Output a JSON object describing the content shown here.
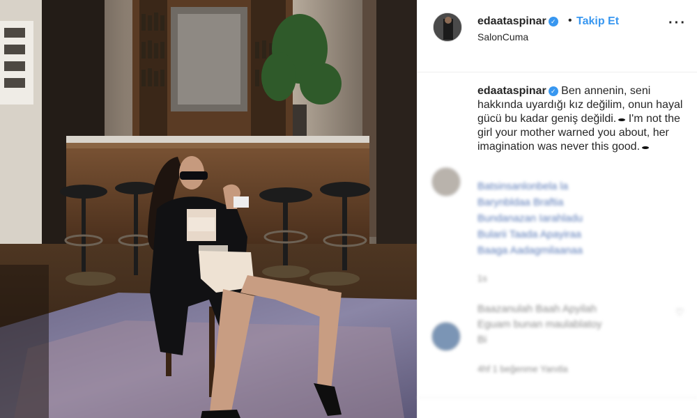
{
  "post": {
    "username": "edaataspinar",
    "follow_separator": "•",
    "follow_label": "Takip Et",
    "location": "SalonCuma",
    "more_label": "···"
  },
  "caption": {
    "username": "edaataspinar",
    "text_tr": "Ben annenin, seni hakkında uyardığı kız değilim, onun hayal gücü bu kadar geniş değildi.",
    "text_en": "I'm not the girl your mother warned you about, her imagination was never this good."
  },
  "comments": [
    {
      "lines": [
        "Batsinsanlonbela la",
        "Barynbldaa Braftia",
        "Bundanazan Iarahladu",
        "Bularii Taada Apayiraa",
        "Baaga Aadagmilaanaa"
      ],
      "meta": "1s"
    },
    {
      "lines": [
        "Baazanulah Baah Apyilah",
        "Eguam bunan maulablatoy",
        "Bi"
      ],
      "meta": "4hf   1 beğenme   Yanıtla"
    }
  ],
  "colors": {
    "accent": "#3897f0",
    "text": "#262626",
    "muted": "#8e8e8e",
    "border": "#efefef"
  }
}
